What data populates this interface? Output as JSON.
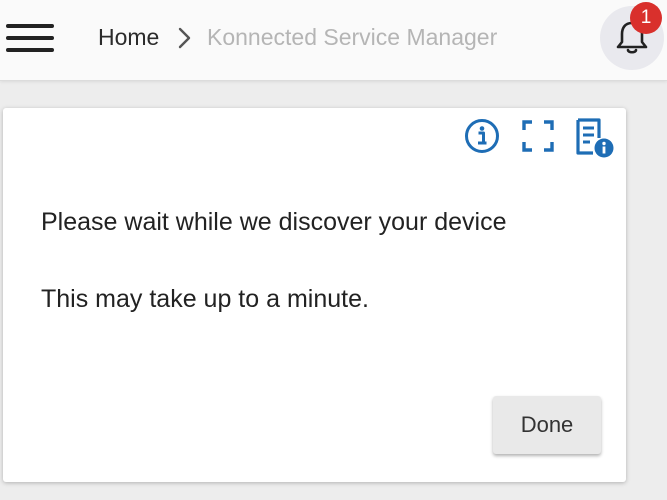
{
  "header": {
    "menu_icon": "hamburger-menu-icon",
    "breadcrumb": {
      "home_label": "Home",
      "separator_icon": "chevron-right-icon",
      "current_label": "Konnected Service Manager"
    },
    "notifications": {
      "icon": "bell-icon",
      "count": "1",
      "badge_color": "#d9302c"
    }
  },
  "dialog": {
    "toolbar": {
      "info_icon": "info-circle-icon",
      "fullscreen_icon": "fullscreen-icon",
      "log_icon": "document-info-icon",
      "icon_color": "#1e6db5"
    },
    "message_line1": "Please wait while we discover your device",
    "message_line2": "This may take up to a minute.",
    "done_label": "Done"
  }
}
